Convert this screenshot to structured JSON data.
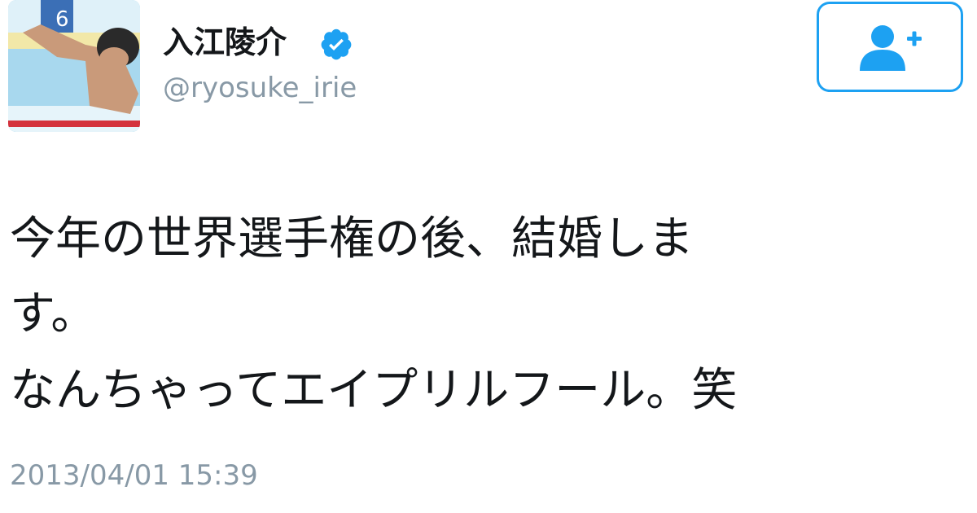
{
  "user": {
    "display_name": "入江陵介",
    "handle": "@ryosuke_irie",
    "verified": true,
    "avatar_icon": "swimmer-photo"
  },
  "follow_button": {
    "icon": "add-user-icon"
  },
  "tweet": {
    "paragraph_1": "今年の世界選手権の後、結婚しま\nす。",
    "paragraph_2": "なんちゃってエイプリルフール。笑",
    "timestamp": "2013/04/01 15:39"
  },
  "colors": {
    "accent": "#1da1f2",
    "text": "#14171a",
    "muted": "#8899a6"
  }
}
